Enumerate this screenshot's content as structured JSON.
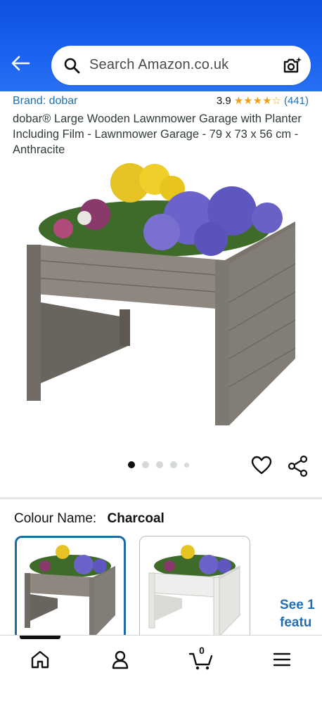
{
  "header": {
    "search_placeholder": "Search Amazon.co.uk"
  },
  "product": {
    "brand_label": "Brand: dobar",
    "rating_value": "3.9",
    "rating_stars": 3.9,
    "rating_count": "(441)",
    "title": "dobar® Large Wooden Lawnmower Garage with Planter Including Film - Lawnmower Garage - 79 x 73 x 56 cm - Anthracite"
  },
  "gallery": {
    "image_count": 5,
    "active_index": 0
  },
  "colour": {
    "label": "Colour Name:",
    "selected": "Charcoal",
    "options": [
      "Charcoal",
      "White"
    ],
    "see_more_line1": "See 1",
    "see_more_line2": "featu"
  },
  "bottom_nav": {
    "items": [
      "home-icon",
      "account-icon",
      "cart-icon",
      "menu-icon"
    ],
    "cart_count": "0"
  },
  "colors": {
    "header_blue": "#1a63f0",
    "link_blue": "#1f6fb2",
    "star_orange": "#f0a11c",
    "selected_border": "#1d6ba5"
  }
}
